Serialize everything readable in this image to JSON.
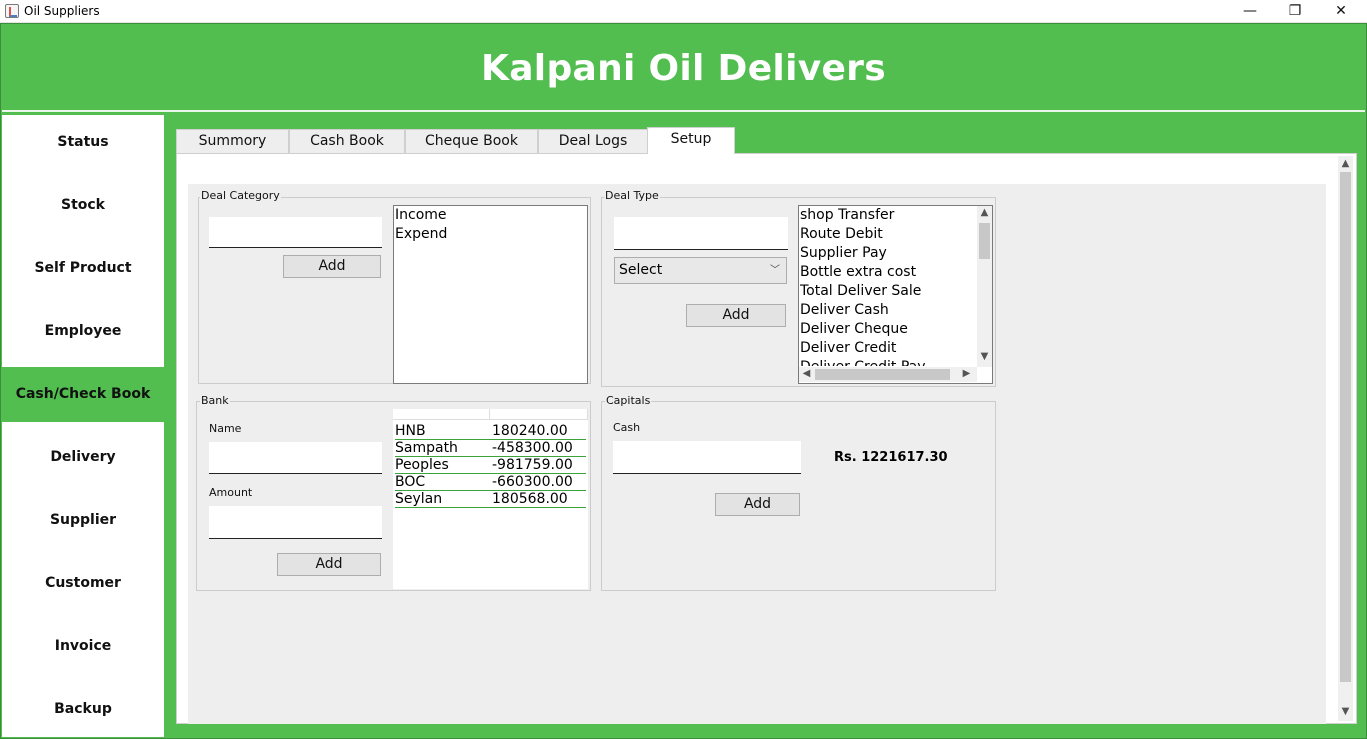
{
  "window": {
    "title": "Oil Suppliers",
    "controls": {
      "minimize": "—",
      "maximize": "❐",
      "close": "✕"
    }
  },
  "header": {
    "title": "Kalpani Oil Delivers"
  },
  "sidebar": {
    "items": [
      {
        "label": "Status"
      },
      {
        "label": "Stock"
      },
      {
        "label": "Self Product"
      },
      {
        "label": "Employee"
      },
      {
        "label": "Cash/Check Book",
        "active": true
      },
      {
        "label": "Delivery"
      },
      {
        "label": "Supplier"
      },
      {
        "label": "Customer"
      },
      {
        "label": "Invoice"
      },
      {
        "label": "Backup"
      }
    ]
  },
  "tabs": [
    {
      "label": "Summory"
    },
    {
      "label": "Cash Book"
    },
    {
      "label": "Cheque Book"
    },
    {
      "label": "Deal Logs"
    },
    {
      "label": "Setup",
      "active": true
    }
  ],
  "deal_category": {
    "title": "Deal Category",
    "input_value": "",
    "add_label": "Add",
    "items": [
      "Income",
      "Expend"
    ]
  },
  "deal_type": {
    "title": "Deal Type",
    "input_value": "",
    "select_value": "Select",
    "add_label": "Add",
    "items": [
      "shop Transfer",
      "Route Debit",
      "Supplier Pay",
      "Bottle extra cost",
      "Total Deliver Sale",
      "Deliver Cash",
      "Deliver Cheque",
      "Deliver Credit",
      "Deliver Credit Pay"
    ]
  },
  "bank": {
    "title": "Bank",
    "name_label": "Name",
    "amount_label": "Amount",
    "add_label": "Add",
    "rows": [
      {
        "name": "HNB",
        "amount": "180240.00"
      },
      {
        "name": "Sampath",
        "amount": "-458300.00"
      },
      {
        "name": "Peoples",
        "amount": "-981759.00"
      },
      {
        "name": "BOC",
        "amount": "-660300.00"
      },
      {
        "name": "Seylan",
        "amount": "180568.00"
      }
    ]
  },
  "capitals": {
    "title": "Capitals",
    "cash_label": "Cash",
    "value": "Rs. 1221617.30",
    "add_label": "Add"
  },
  "colors": {
    "accent": "#51be4f",
    "table_rule": "#3aa33a"
  }
}
